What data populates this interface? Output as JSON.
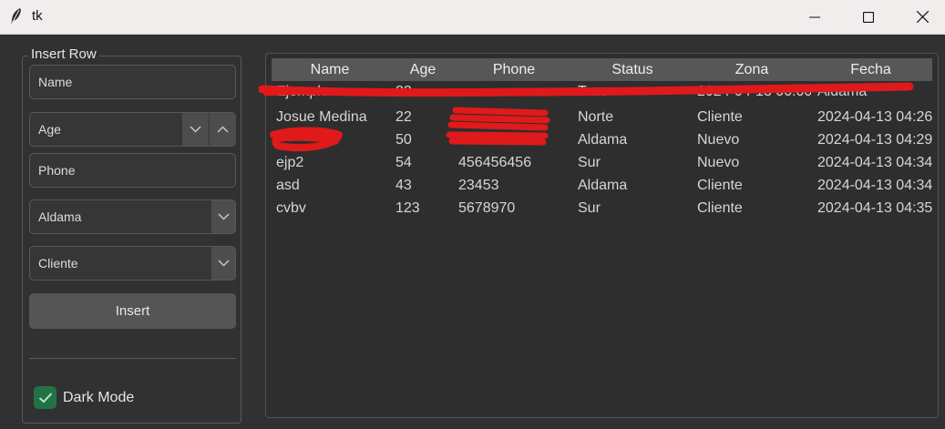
{
  "window": {
    "title": "tk"
  },
  "left_panel": {
    "frame_title": "Insert Row",
    "name_placeholder": "Name",
    "age_value": "Age",
    "phone_placeholder": "Phone",
    "zona_value": "Aldama",
    "status_value": "Cliente",
    "insert_label": "Insert",
    "dark_mode_label": "Dark Mode",
    "dark_mode_checked": true
  },
  "table": {
    "columns": [
      "Name",
      "Age",
      "Phone",
      "Status",
      "Zona",
      "Fecha"
    ],
    "rows": [
      [
        "Ejemplo",
        "22",
        "",
        "True",
        "2024-04-13 00:00",
        "Aldama"
      ],
      [
        "Josue Medina",
        "22",
        "",
        "Norte",
        "Cliente",
        "2024-04-13 04:26"
      ],
      [
        "",
        "50",
        "",
        "Aldama",
        "Nuevo",
        "2024-04-13 04:29"
      ],
      [
        "ejp2",
        "54",
        "456456456",
        "Sur",
        "Nuevo",
        "2024-04-13 04:34"
      ],
      [
        "asd",
        "43",
        "23453",
        "Aldama",
        "Cliente",
        "2024-04-13 04:34"
      ],
      [
        "cvbv",
        "123",
        "5678970",
        "Sur",
        "Cliente",
        "2024-04-13 04:35"
      ]
    ]
  },
  "colors": {
    "background": "#313131",
    "checkbox_accent": "#217346",
    "redaction": "#e0191b"
  }
}
